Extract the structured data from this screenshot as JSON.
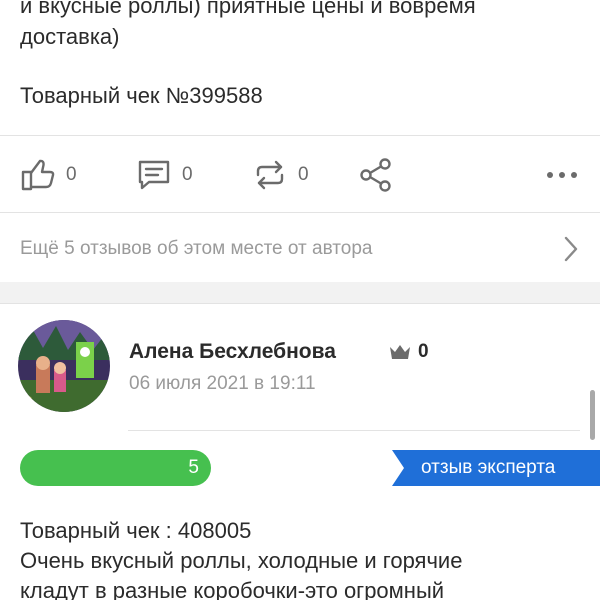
{
  "previous_review": {
    "text_line1": "и вкусные роллы) приятные цены и вовремя",
    "text_line2": "доставка)",
    "receipt": "Товарный чек №399588"
  },
  "actions": {
    "likes": "0",
    "comments": "0",
    "reposts": "0"
  },
  "more_reviews_text": "Ещё 5 отзывов об этом месте от автора",
  "review": {
    "author": "Алена Бесхлебнова",
    "crown_count": "0",
    "date": "06 июля 2021 в 19:11",
    "rating": "5",
    "badge": "отзыв эксперта",
    "body_line1": "Товарный чек : 408005",
    "body_line2": "Очень вкусный роллы, холодные и горячие",
    "body_line3": "кладут в разные коробочки-это огромный"
  },
  "colors": {
    "rating_green": "#46c04f",
    "expert_blue": "#1f6fd8",
    "icon_gray": "#6b6b6b",
    "muted_text": "#9a9a9a"
  },
  "icons": [
    "thumbs-up-icon",
    "comment-icon",
    "repost-icon",
    "share-icon",
    "more-icon",
    "chevron-right-icon",
    "crown-icon"
  ]
}
